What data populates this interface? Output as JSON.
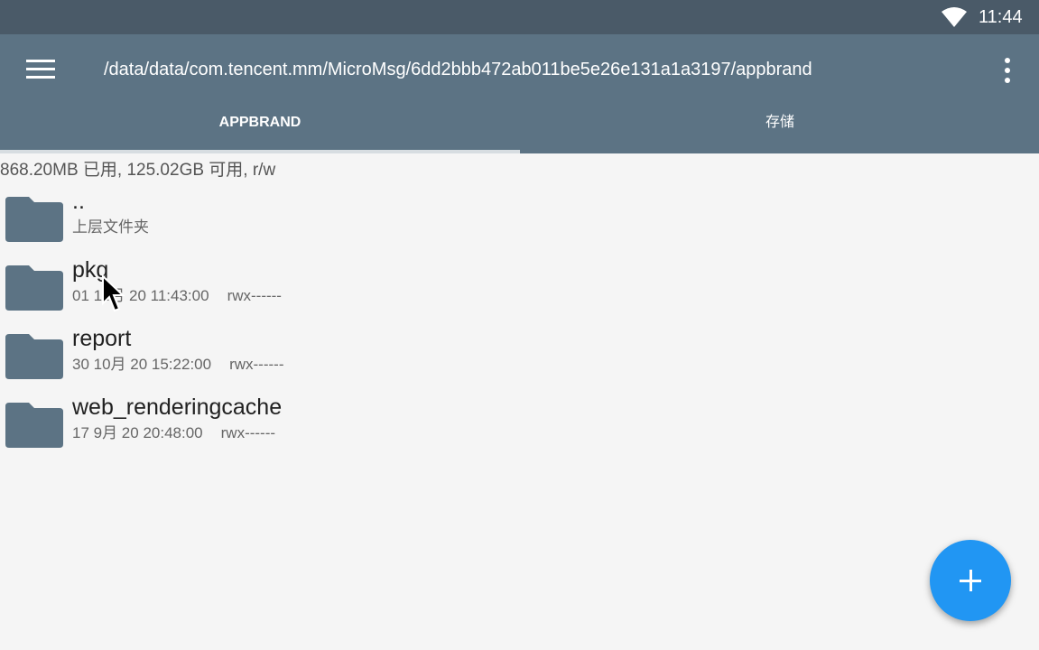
{
  "status_bar": {
    "time": "11:44",
    "wifi_icon": "wifi-icon"
  },
  "toolbar": {
    "menu_icon": "hamburger-menu-icon",
    "path": "/data/data/com.tencent.mm/MicroMsg/6dd2bbb472ab011be5e26e131a1a3197/appbrand",
    "overflow_icon": "more-vert-icon"
  },
  "tabs": [
    {
      "label": "APPBRAND",
      "active": true
    },
    {
      "label": "存储",
      "active": false
    }
  ],
  "storage_info": "868.20MB 已用, 125.02GB 可用, r/w",
  "files": [
    {
      "name": "..",
      "date": "上层文件夹",
      "perm": ""
    },
    {
      "name": "pkg",
      "date": "01 11月 20 11:43:00",
      "perm": "rwx------"
    },
    {
      "name": "report",
      "date": "30 10月 20 15:22:00",
      "perm": "rwx------"
    },
    {
      "name": "web_renderingcache",
      "date": "17 9月 20 20:48:00",
      "perm": "rwx------"
    }
  ],
  "fab": {
    "icon": "add-icon"
  },
  "colors": {
    "status_bar": "#4a5a68",
    "toolbar": "#5c7384",
    "folder": "#5c7384",
    "fab": "#2196f3",
    "background": "#f5f5f5"
  }
}
